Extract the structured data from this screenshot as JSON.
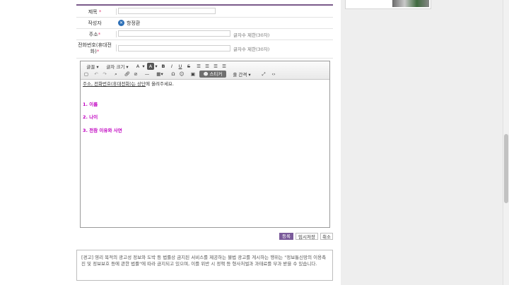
{
  "form": {
    "title_label": "제목",
    "author_label": "작성자",
    "author_name": "항정환",
    "author_icon": "user-icon",
    "address_label": "주소",
    "address_hint": "글자수 제한(30자)",
    "phone_label_line1": "전화번호(휴대전",
    "phone_label_line2": "화)",
    "phone_hint": "글자수 제한(30자)",
    "required_mark": "*"
  },
  "toolbar": {
    "font": "글꼴",
    "size": "글자 크기",
    "sticker": "스티커",
    "line_height": "줄 간격",
    "bold": "B",
    "italic": "I",
    "underline": "U",
    "strike": "S",
    "text_color": "A",
    "bg_color": "A",
    "omega": "Ω",
    "code": "‹›"
  },
  "editor": {
    "guide_prefix": "주소, 전화번호(휴대전화)",
    "guide_underlined": "는 상단",
    "guide_suffix": "에 올려주세요.",
    "item1": "1. 이름",
    "item2": "2. 나이",
    "item3": "3. 전참 이유와 사연"
  },
  "actions": {
    "submit": "등록",
    "draft": "임시저장",
    "cancel": "취소"
  },
  "notice": {
    "text": "[경고] 영리 목적의 광고성 정보와 도박 등 법률상 금지된 서비스를 제공하는 불법 광고를 게시하는 행위는 \"정보통신망의 이용촉진 및 정보보호 등에 관한 법률\"에 따라 금지되고 있으며, 이를 위반 시 정책 등 형사처벌과 과태료를 부과 받을 수 있습니다."
  },
  "colors": {
    "accent": "#7a5a9a",
    "highlight_text": "#c000c0",
    "required": "#e0457b"
  }
}
